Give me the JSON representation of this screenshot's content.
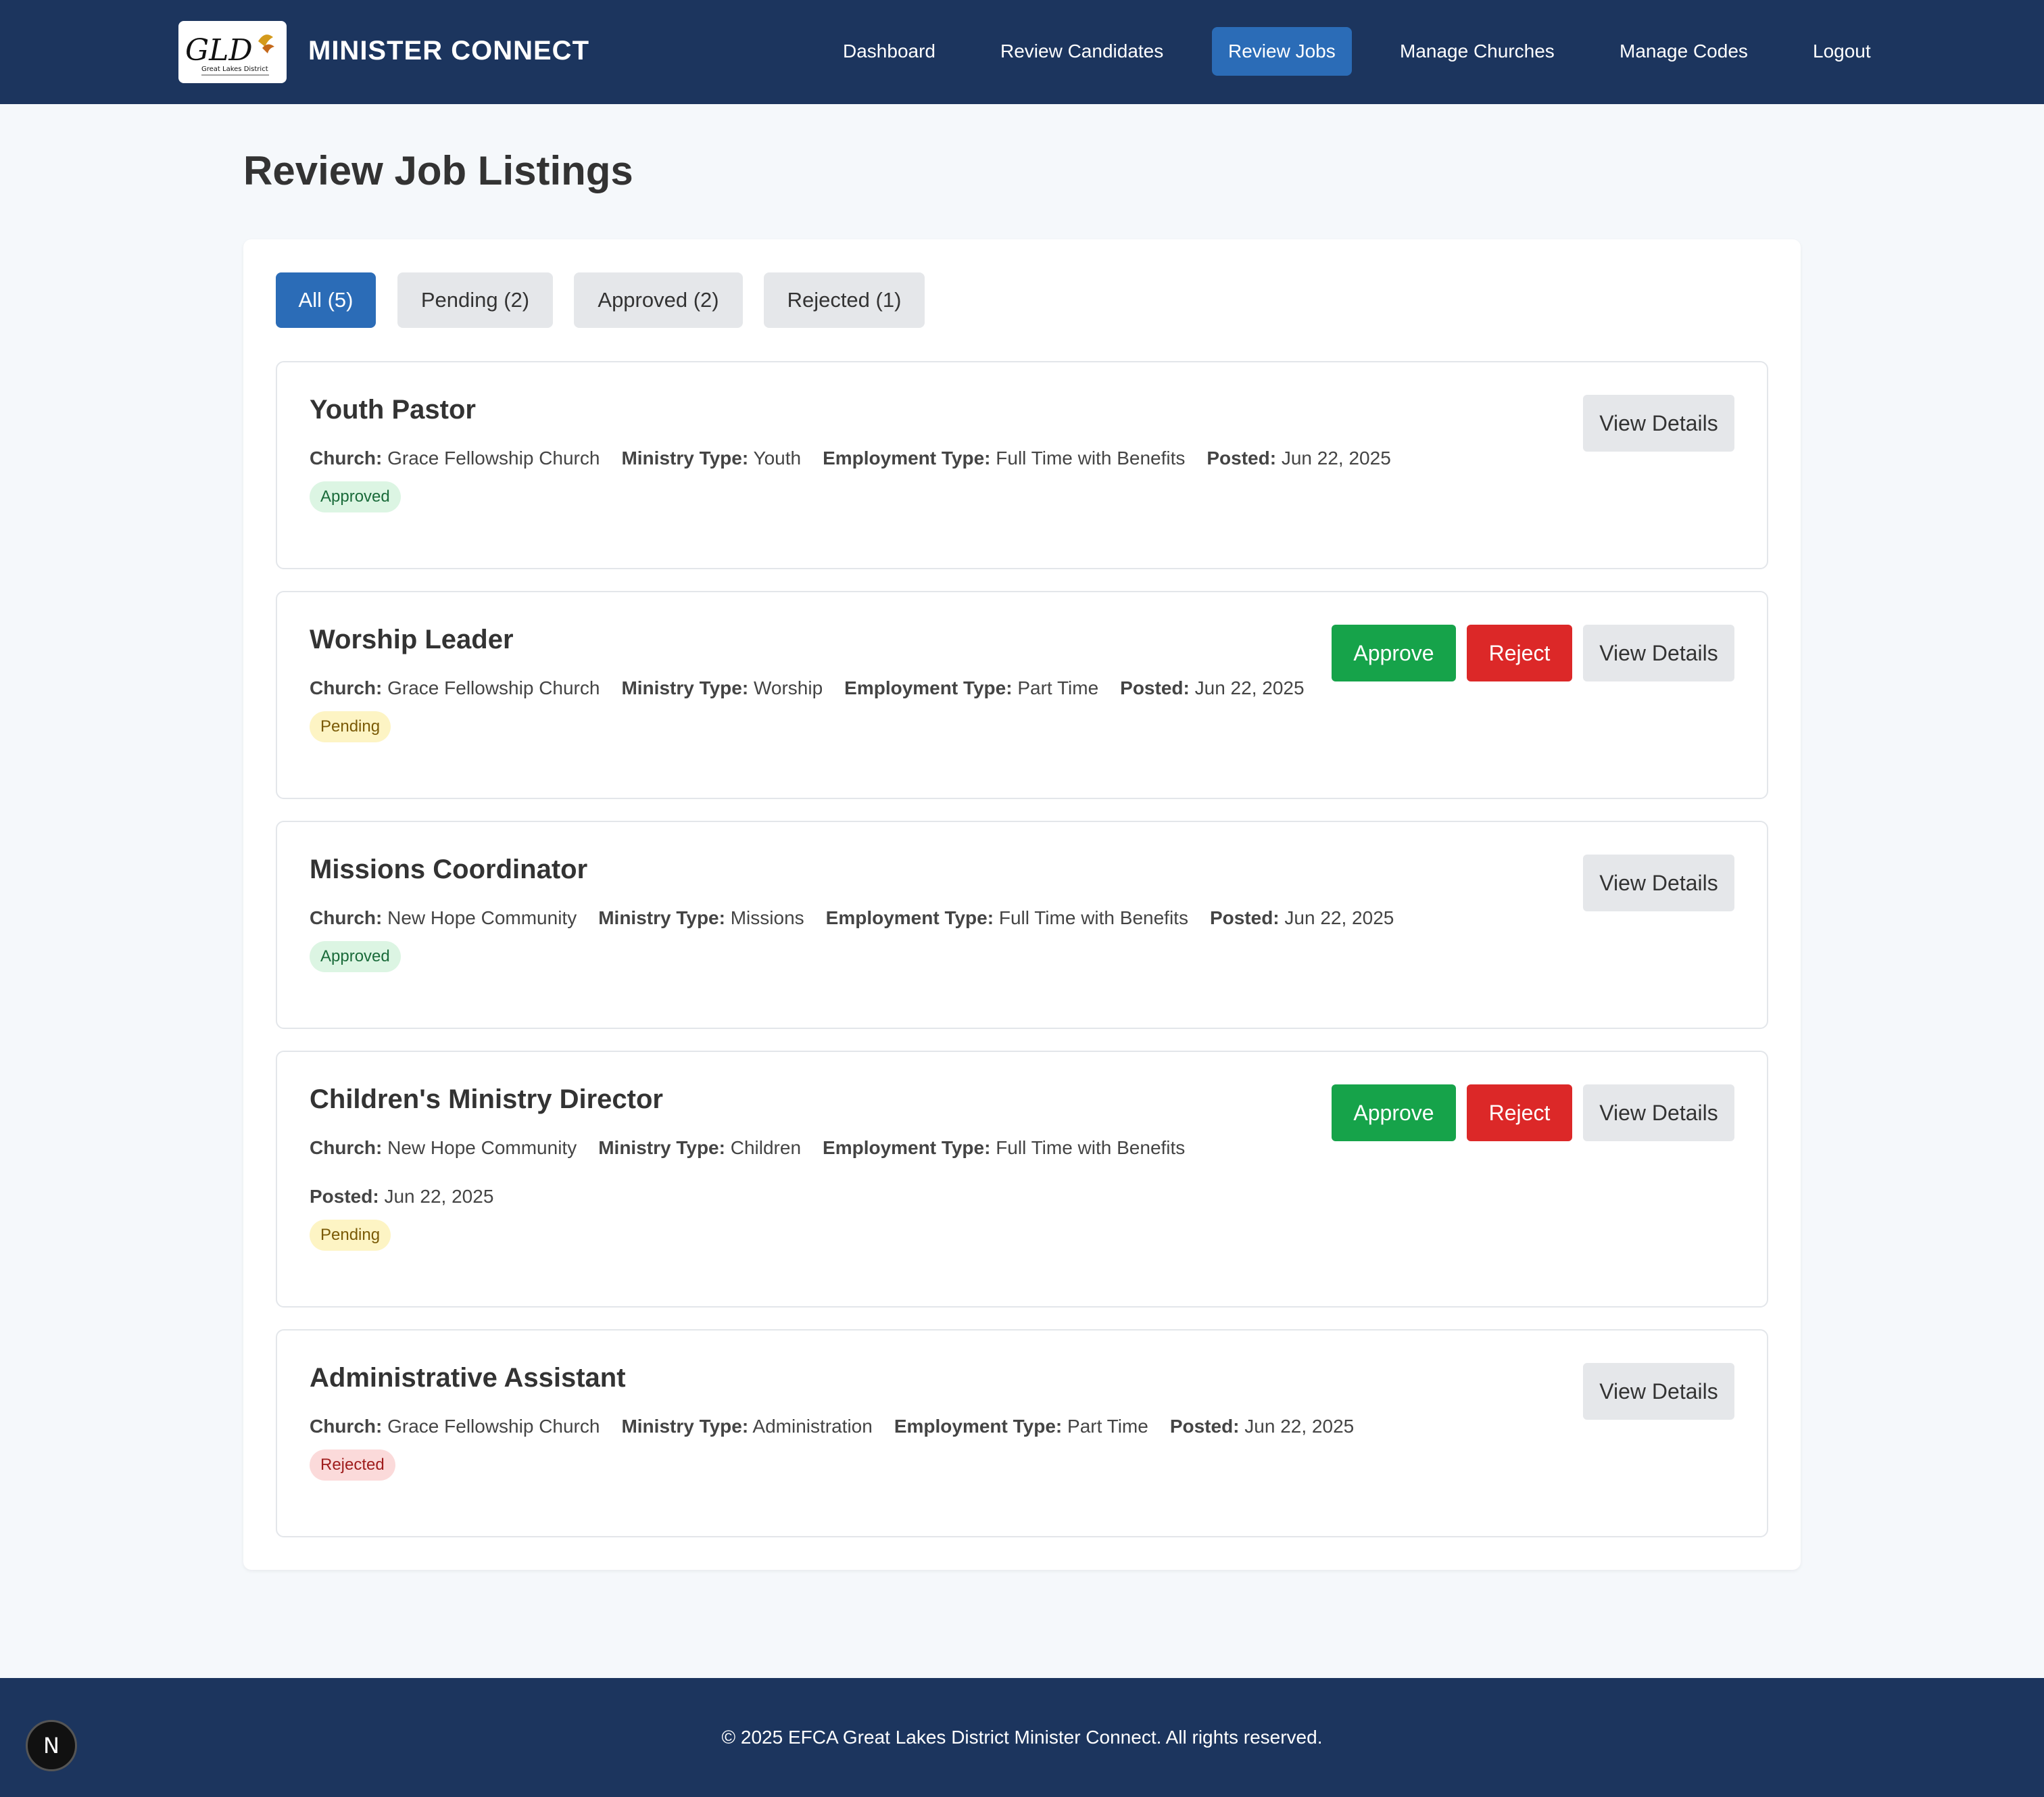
{
  "header": {
    "logo_text": "GLD",
    "logo_subtext": "Great Lakes District",
    "brand": "MINISTER CONNECT",
    "nav": [
      {
        "label": "Dashboard"
      },
      {
        "label": "Review Candidates"
      },
      {
        "label": "Review Jobs"
      },
      {
        "label": "Manage Churches"
      },
      {
        "label": "Manage Codes"
      },
      {
        "label": "Logout"
      }
    ],
    "active_nav": "Review Jobs"
  },
  "page": {
    "title": "Review Job Listings"
  },
  "filters": [
    {
      "label": "All (5)",
      "active": true
    },
    {
      "label": "Pending (2)",
      "active": false
    },
    {
      "label": "Approved (2)",
      "active": false
    },
    {
      "label": "Rejected (1)",
      "active": false
    }
  ],
  "labels": {
    "church": "Church:",
    "ministry_type": "Ministry Type:",
    "employment_type": "Employment Type:",
    "posted": "Posted:",
    "approve": "Approve",
    "reject": "Reject",
    "view_details": "View Details"
  },
  "jobs": [
    {
      "title": "Youth Pastor",
      "church": "Grace Fellowship Church",
      "ministry_type": "Youth",
      "employment_type": "Full Time with Benefits",
      "posted": "Jun 22, 2025",
      "status": "Approved"
    },
    {
      "title": "Worship Leader",
      "church": "Grace Fellowship Church",
      "ministry_type": "Worship",
      "employment_type": "Part Time",
      "posted": "Jun 22, 2025",
      "status": "Pending"
    },
    {
      "title": "Missions Coordinator",
      "church": "New Hope Community",
      "ministry_type": "Missions",
      "employment_type": "Full Time with Benefits",
      "posted": "Jun 22, 2025",
      "status": "Approved"
    },
    {
      "title": "Children's Ministry Director",
      "church": "New Hope Community",
      "ministry_type": "Children",
      "employment_type": "Full Time with Benefits",
      "posted": "Jun 22, 2025",
      "status": "Pending"
    },
    {
      "title": "Administrative Assistant",
      "church": "Grace Fellowship Church",
      "ministry_type": "Administration",
      "employment_type": "Part Time",
      "posted": "Jun 22, 2025",
      "status": "Rejected"
    }
  ],
  "footer": {
    "text": "© 2025 EFCA Great Lakes District Minister Connect. All rights reserved.",
    "dev_badge": "N"
  },
  "colors": {
    "header_bg": "#1c355e",
    "accent": "#2b6cb7",
    "approve": "#16a34a",
    "reject": "#dc2828"
  }
}
